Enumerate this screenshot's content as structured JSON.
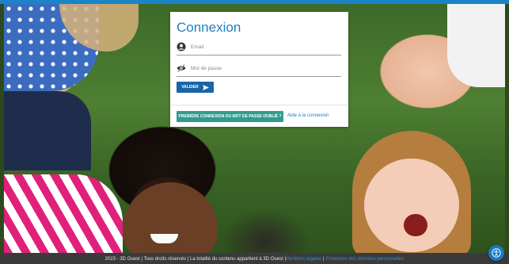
{
  "login": {
    "title": "Connexion",
    "email_placeholder": "Email",
    "password_placeholder": "Mot de passe",
    "validate_label": "VALIDER",
    "first_login_label": "PREMIÈRE CONNEXION OU MOT DE PASSE OUBLIÉ ?",
    "help_label": "Aide à la connexion"
  },
  "footer": {
    "copyright": "2023 - 3D Ouest | Tous droits réservés | La totalité du contenu appartient à 3D Ouest |",
    "legal_link": "Mentions légales",
    "separator": "|",
    "privacy_link": "Protection des données personnelles"
  },
  "icons": {
    "email": "user-circle-icon",
    "password": "eye-slash-icon",
    "validate": "send-arrow-icon",
    "fab": "accessibility-icon"
  },
  "colors": {
    "top_bar": "#1a84c7",
    "title": "#1e7fc1",
    "validate_button": "#1765a8",
    "first_login_button": "#2f9c8e",
    "footer_bg": "#3a3a3a",
    "link": "#2f8fd6"
  }
}
